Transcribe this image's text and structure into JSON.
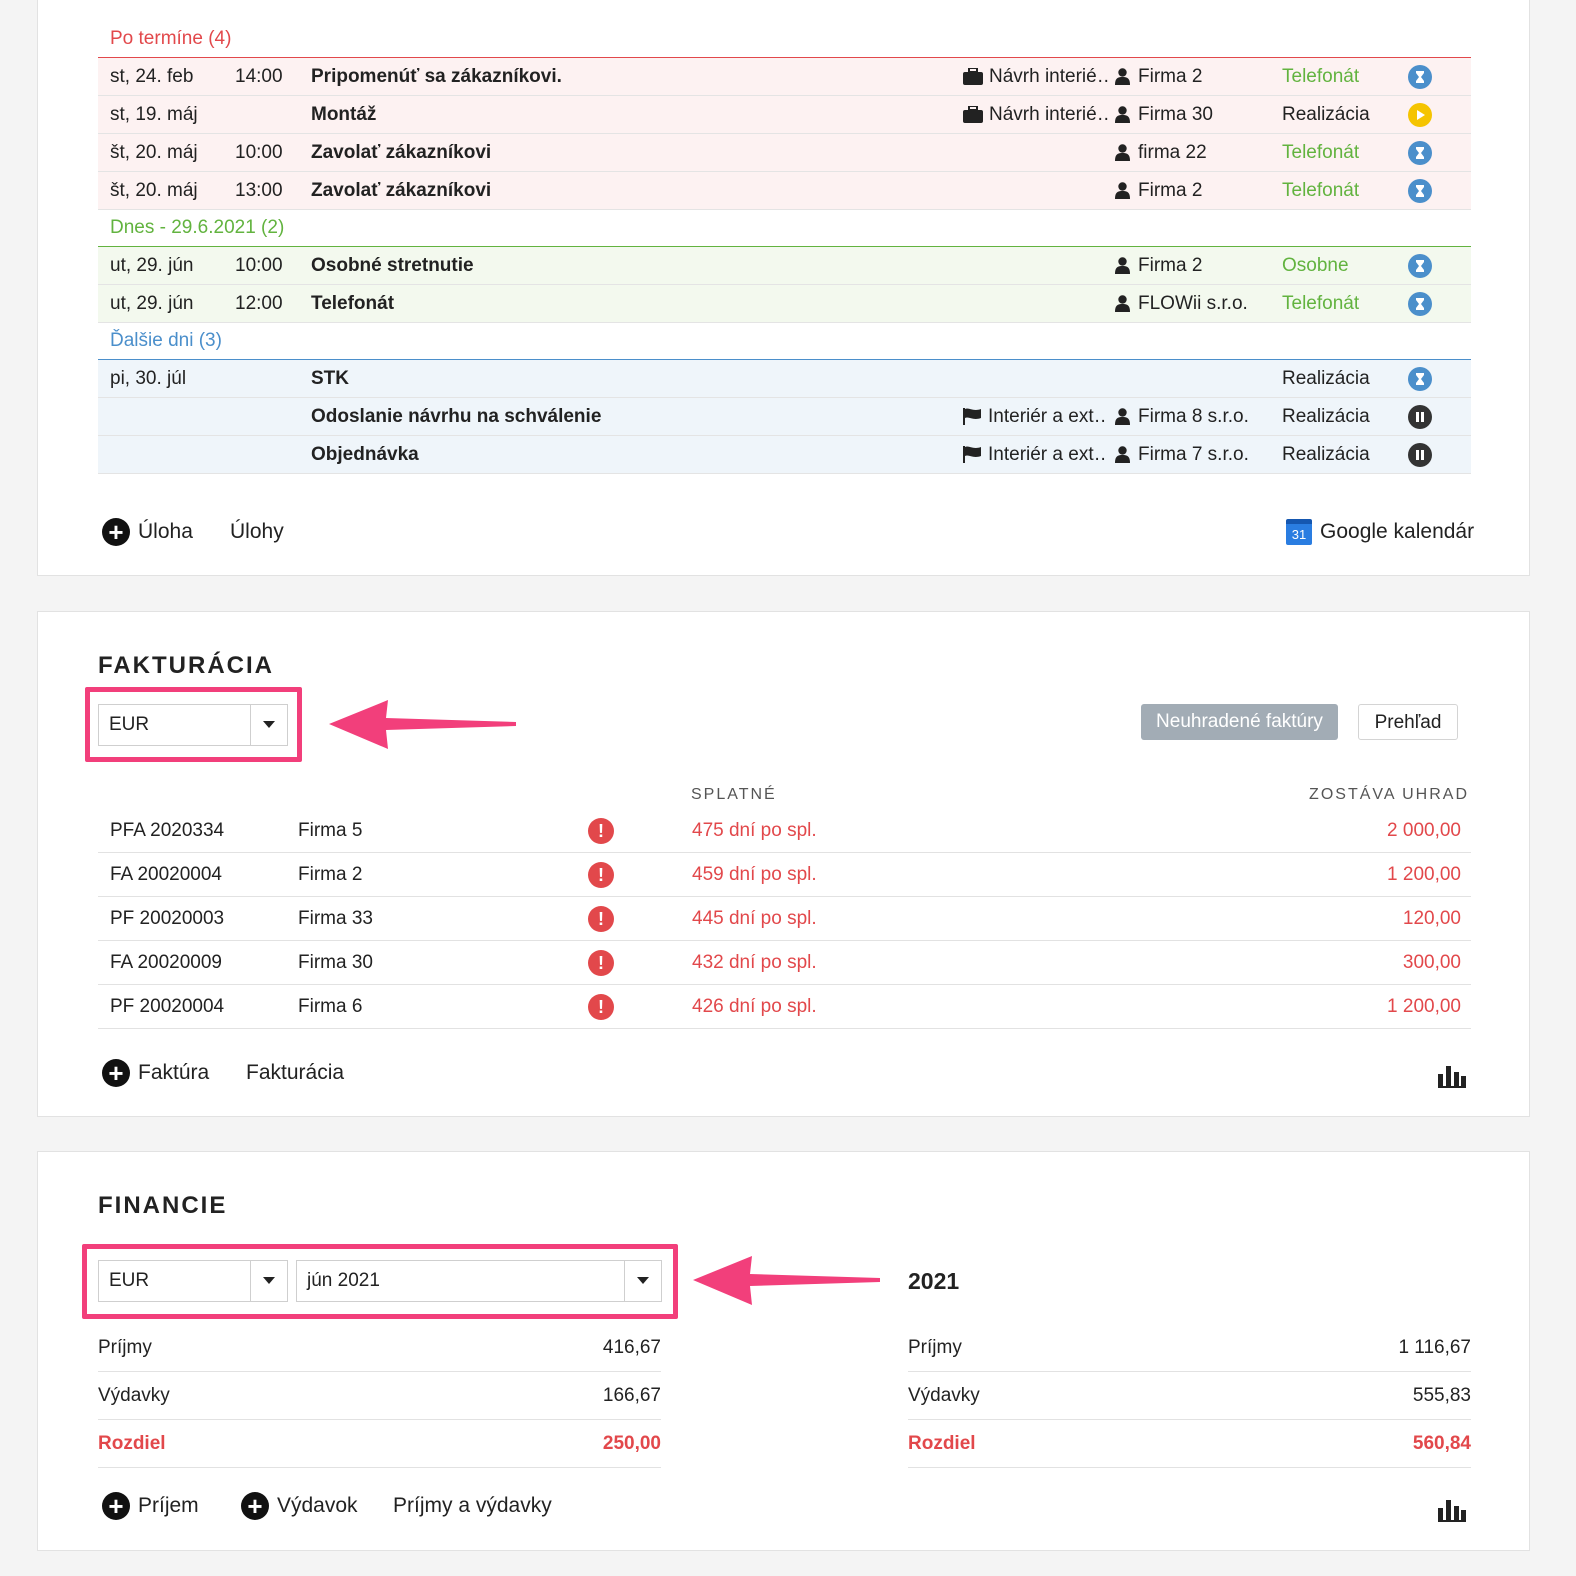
{
  "tasks": {
    "groups": {
      "overdue": "Po termíne (4)",
      "today": "Dnes - 29.6.2021 (2)",
      "next": "Ďalšie dni (3)"
    },
    "overdue_rows": [
      {
        "date": "st, 24. feb",
        "time": "14:00",
        "title": "Pripomenúť sa zákazníkovi.",
        "project": "Návrh interié…",
        "customer": "Firma 2",
        "type": "Telefonát",
        "status": "hourglass"
      },
      {
        "date": "st, 19. máj",
        "time": "",
        "title": "Montáž",
        "project": "Návrh interié…",
        "customer": "Firma 30",
        "type": "Realizácia",
        "status": "play"
      },
      {
        "date": "št, 20. máj",
        "time": "10:00",
        "title": "Zavolať zákazníkovi",
        "project": "",
        "customer": "firma 22",
        "type": "Telefonát",
        "status": "hourglass"
      },
      {
        "date": "št, 20. máj",
        "time": "13:00",
        "title": "Zavolať zákazníkovi",
        "project": "",
        "customer": "Firma 2",
        "type": "Telefonát",
        "status": "hourglass"
      }
    ],
    "today_rows": [
      {
        "date": "ut, 29. jún",
        "time": "10:00",
        "title": "Osobné stretnutie",
        "project": "",
        "customer": "Firma 2",
        "type": "Osobne",
        "status": "hourglass"
      },
      {
        "date": "ut, 29. jún",
        "time": "12:00",
        "title": "Telefonát",
        "project": "",
        "customer": "FLOWii s.r.o.",
        "type": "Telefonát",
        "status": "hourglass"
      }
    ],
    "next_rows": [
      {
        "date": "pi, 30. júl",
        "time": "",
        "title": "STK",
        "project": "",
        "customer": "",
        "type": "Realizácia",
        "status": "hourglass"
      },
      {
        "date": "",
        "time": "",
        "title": "Odoslanie návrhu na schválenie",
        "project": "Interiér a ext…",
        "customer": "Firma 8 s.r.o.",
        "type": "Realizácia",
        "status": "pause"
      },
      {
        "date": "",
        "time": "",
        "title": "Objednávka",
        "project": "Interiér a ext…",
        "customer": "Firma 7 s.r.o.",
        "type": "Realizácia",
        "status": "pause"
      }
    ],
    "footer": {
      "add_task": "Úloha",
      "tasks_link": "Úlohy",
      "gcal_label": "Google kalendár",
      "gcal_day": "31"
    }
  },
  "billing": {
    "title": "FAKTURÁCIA",
    "currency": "EUR",
    "btn_unpaid": "Neuhradené faktúry",
    "btn_overview": "Prehľad",
    "col_due": "SPLATNÉ",
    "col_remaining": "ZOSTÁVA UHRAD",
    "invoices": [
      {
        "number": "PFA 2020334",
        "customer": "Firma 5",
        "due": "475 dní po spl.",
        "amount": "2 000,00"
      },
      {
        "number": "FA 20020004",
        "customer": "Firma 2",
        "due": "459 dní po spl.",
        "amount": "1 200,00"
      },
      {
        "number": "PF 20020003",
        "customer": "Firma 33",
        "due": "445 dní po spl.",
        "amount": "120,00"
      },
      {
        "number": "FA 20020009",
        "customer": "Firma 30",
        "due": "432 dní po spl.",
        "amount": "300,00"
      },
      {
        "number": "PF 20020004",
        "customer": "Firma 6",
        "due": "426 dní po spl.",
        "amount": "1 200,00"
      }
    ],
    "footer": {
      "add_invoice": "Faktúra",
      "billing_link": "Fakturácia"
    }
  },
  "finance": {
    "title": "FINANCIE",
    "currency": "EUR",
    "month": "jún 2021",
    "year_title": "2021",
    "month_rows": [
      {
        "label": "Príjmy",
        "value": "416,67"
      },
      {
        "label": "Výdavky",
        "value": "166,67"
      },
      {
        "label": "Rozdiel",
        "value": "250,00"
      }
    ],
    "year_rows": [
      {
        "label": "Príjmy",
        "value": "1 116,67"
      },
      {
        "label": "Výdavky",
        "value": "555,83"
      },
      {
        "label": "Rozdiel",
        "value": "560,84"
      }
    ],
    "footer": {
      "add_income": "Príjem",
      "add_expense": "Výdavok",
      "link": "Príjmy a výdavky"
    }
  },
  "colors": {
    "overdue": "#e2484b",
    "today": "#62b33f",
    "next": "#4b8fcb",
    "highlight": "#f23f7b"
  }
}
